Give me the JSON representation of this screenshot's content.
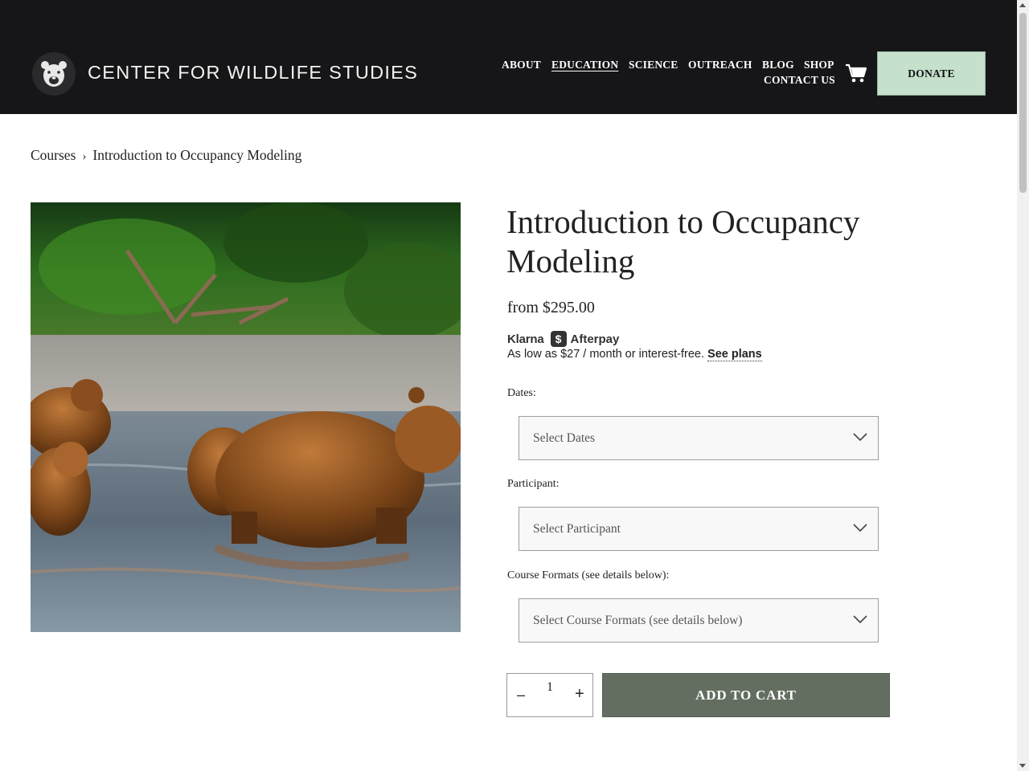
{
  "header": {
    "site_title": "CENTER FOR WILDLIFE STUDIES",
    "logo_icon": "bear-logo-icon",
    "nav": {
      "about": "ABOUT",
      "education": "EDUCATION",
      "science": "SCIENCE",
      "outreach": "OUTREACH",
      "blog": "BLOG",
      "shop": "SHOP",
      "contact": "CONTACT US"
    },
    "active_nav": "EDUCATION",
    "cart_icon": "cart-icon",
    "donate_label": "DONATE"
  },
  "breadcrumb": {
    "parent": "Courses",
    "separator": "›",
    "current": "Introduction to Occupancy Modeling"
  },
  "product": {
    "image_icon": "brown-bears-photo",
    "title": "Introduction to Occupancy Modeling",
    "price": "from $295.00",
    "bnpl": {
      "klarna": "Klarna",
      "afterpay_badge": "$",
      "afterpay": "Afterpay",
      "text": "As low as $27 / month or interest-free.",
      "link": "See plans"
    },
    "fields": {
      "dates_label": "Dates:",
      "dates_placeholder": "Select Dates",
      "participant_label": "Participant:",
      "participant_placeholder": "Select Participant",
      "format_label": "Course Formats (see details below):",
      "format_placeholder": "Select Course Formats (see details below)"
    },
    "quantity": {
      "minus": "–",
      "value": "1",
      "plus": "+"
    },
    "add_to_cart": "ADD TO CART"
  },
  "colors": {
    "header_bg": "#161618",
    "donate_bg": "#c5e0cb",
    "add_to_cart_bg": "#636e60"
  }
}
